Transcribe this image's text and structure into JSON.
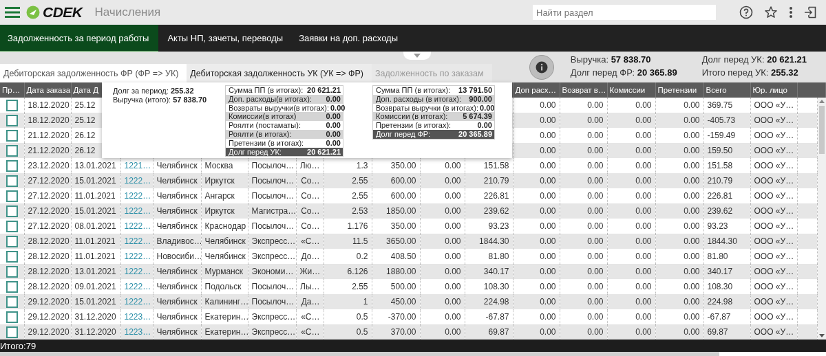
{
  "header": {
    "logo": "CDEK",
    "title": "Начисления",
    "search": {
      "placeholder": "Найти раздел"
    }
  },
  "nav_tabs": [
    {
      "label": "Задолженность за период работы",
      "selected": true
    },
    {
      "label": "Акты НП, зачеты, переводы",
      "selected": false
    },
    {
      "label": "Заявки на доп. расходы",
      "selected": false
    }
  ],
  "sub_tabs": [
    {
      "label": "Дебиторская задолженность ФР (ФР => УК)",
      "selected": true,
      "disabled": false
    },
    {
      "label": "Дебиторская задолженность УК (УК => ФР)",
      "selected": false,
      "disabled": false
    },
    {
      "label": "Задолженность по заказам",
      "selected": false,
      "disabled": true
    }
  ],
  "summary": [
    {
      "label": "Выручка:",
      "value": "57 838.70"
    },
    {
      "label": "Долг перед ФР:",
      "value": "20 365.89"
    },
    {
      "label": "Долг перед УК:",
      "value": "20 621.21"
    },
    {
      "label": "Итого перед УК:",
      "value": "255.32"
    }
  ],
  "popup": {
    "lines": [
      {
        "label": "Долг за период:",
        "value": "255.32"
      },
      {
        "label": "Выручка (итого):",
        "value": "57 838.70"
      }
    ],
    "tables": [
      {
        "rows": [
          {
            "label": "Сумма ПП (в итогах):",
            "value": "20 621.21"
          },
          {
            "label": "Доп. расходы(в итогах):",
            "value": "0.00"
          },
          {
            "label": "Возвраты выручки(в итогах):",
            "value": "0.00"
          },
          {
            "label": "Комиссии(в итогах)",
            "value": "0.00"
          },
          {
            "label": "Роялти (постаматы):",
            "value": "0.00"
          },
          {
            "label": "Роялти (в итогах):",
            "value": "0.00"
          },
          {
            "label": "Претензии (в итогах):",
            "value": "0.00"
          }
        ],
        "total": {
          "label": "Долг перед УК:",
          "value": "20 621.21"
        }
      },
      {
        "rows": [
          {
            "label": "Сумма ПП (в итогах):",
            "value": "13 791.50"
          },
          {
            "label": "Доп. расходы (в итогах):",
            "value": "900.00"
          },
          {
            "label": "Возвраты выручки (в итогах):",
            "value": "0.00"
          },
          {
            "label": "Комиссии (в итогах):",
            "value": "5 674.39"
          },
          {
            "label": "Претензии (в итогах):",
            "value": "0.00"
          }
        ],
        "total": {
          "label": "Долг перед ФР:",
          "value": "20 365.89"
        }
      }
    ]
  },
  "table": {
    "checkbox_column": "Пр…",
    "columns": [
      "Дата заказа",
      "Дата Д",
      null,
      null,
      null,
      null,
      null,
      null,
      null,
      null,
      null,
      "Доп расх…",
      "Возврат в…",
      "Комиссии",
      "Претензии",
      "Всего",
      "Юр. лицо"
    ],
    "rows": [
      {
        "checked": false,
        "cells": [
          "18.12.2020",
          "25.12",
          null,
          null,
          null,
          null,
          null,
          null,
          null,
          null,
          null,
          "0.00",
          "0.00",
          "0.00",
          "0.00",
          "369.75",
          "ООО «У…"
        ]
      },
      {
        "checked": false,
        "cells": [
          "18.12.2020",
          "25.12",
          null,
          null,
          null,
          null,
          null,
          null,
          null,
          null,
          null,
          "0.00",
          "0.00",
          "0.00",
          "0.00",
          "-405.73",
          "ООО «У…"
        ]
      },
      {
        "checked": false,
        "cells": [
          "21.12.2020",
          "26.12",
          null,
          null,
          null,
          null,
          null,
          null,
          null,
          null,
          null,
          "0.00",
          "0.00",
          "0.00",
          "0.00",
          "-159.49",
          "ООО «У…"
        ]
      },
      {
        "checked": false,
        "cells": [
          "21.12.2020",
          "26.12",
          null,
          null,
          null,
          null,
          null,
          null,
          null,
          null,
          null,
          "0.00",
          "0.00",
          "0.00",
          "0.00",
          "159.50",
          "ООО «У…"
        ]
      },
      {
        "checked": false,
        "cells": [
          "23.12.2020",
          "13.01.2021",
          "1221…",
          "Челябинск",
          "Москва",
          "Посылоч…",
          "Лю…",
          "1.3",
          "350.00",
          "0.00",
          "151.58",
          "0.00",
          "0.00",
          "0.00",
          "0.00",
          "151.58",
          "ООО «У…"
        ]
      },
      {
        "checked": false,
        "cells": [
          "27.12.2020",
          "15.01.2021",
          "1222…",
          "Челябинск",
          "Иркутск",
          "Посылоч…",
          "Со…",
          "2.55",
          "600.00",
          "0.00",
          "210.79",
          "0.00",
          "0.00",
          "0.00",
          "0.00",
          "210.79",
          "ООО «У…"
        ]
      },
      {
        "checked": false,
        "cells": [
          "27.12.2020",
          "11.01.2021",
          "1222…",
          "Челябинск",
          "Ангарск",
          "Посылоч…",
          "Со…",
          "2.55",
          "600.00",
          "0.00",
          "226.81",
          "0.00",
          "0.00",
          "0.00",
          "0.00",
          "226.81",
          "ООО «У…"
        ]
      },
      {
        "checked": false,
        "cells": [
          "27.12.2020",
          "15.01.2021",
          "1222…",
          "Челябинск",
          "Иркутск",
          "Магистра…",
          "Со…",
          "2.53",
          "1850.00",
          "0.00",
          "239.62",
          "0.00",
          "0.00",
          "0.00",
          "0.00",
          "239.62",
          "ООО «У…"
        ]
      },
      {
        "checked": false,
        "cells": [
          "27.12.2020",
          "08.01.2021",
          "1222…",
          "Челябинск",
          "Краснодар",
          "Посылоч…",
          "Со…",
          "1.176",
          "350.00",
          "0.00",
          "93.23",
          "0.00",
          "0.00",
          "0.00",
          "0.00",
          "93.23",
          "ООО «У…"
        ]
      },
      {
        "checked": false,
        "cells": [
          "28.12.2020",
          "11.01.2021",
          "1222…",
          "Владивос…",
          "Челябинск",
          "Экспресс…",
          "«С…",
          "11.5",
          "3650.00",
          "0.00",
          "1844.30",
          "0.00",
          "0.00",
          "0.00",
          "0.00",
          "1844.30",
          "ООО «У…"
        ]
      },
      {
        "checked": false,
        "cells": [
          "28.12.2020",
          "11.01.2021",
          "1222…",
          "Новосиби…",
          "Челябинск",
          "Экспресс…",
          "До…",
          "0.2",
          "408.50",
          "0.00",
          "81.80",
          "0.00",
          "0.00",
          "0.00",
          "0.00",
          "81.80",
          "ООО «У…"
        ]
      },
      {
        "checked": false,
        "cells": [
          "28.12.2020",
          "13.01.2021",
          "1222…",
          "Челябинск",
          "Мурманск",
          "Экономи…",
          "Жи…",
          "6.126",
          "1880.00",
          "0.00",
          "340.17",
          "0.00",
          "0.00",
          "0.00",
          "0.00",
          "340.17",
          "ООО «У…"
        ]
      },
      {
        "checked": false,
        "cells": [
          "28.12.2020",
          "09.01.2021",
          "1222…",
          "Челябинск",
          "Подольск",
          "Посылоч…",
          "Лы…",
          "2.55",
          "500.00",
          "0.00",
          "108.30",
          "0.00",
          "0.00",
          "0.00",
          "0.00",
          "108.30",
          "ООО «У…"
        ]
      },
      {
        "checked": false,
        "cells": [
          "29.12.2020",
          "15.01.2021",
          "1222…",
          "Челябинск",
          "Калининг…",
          "Посылоч…",
          "Да…",
          "1",
          "450.00",
          "0.00",
          "224.98",
          "0.00",
          "0.00",
          "0.00",
          "0.00",
          "224.98",
          "ООО «У…"
        ]
      },
      {
        "checked": false,
        "cells": [
          "29.12.2020",
          "31.12.2020",
          "1223…",
          "Челябинск",
          "Екатерин…",
          "Экспресс…",
          "«С…",
          "0.5",
          "-370.00",
          "0.00",
          "-67.87",
          "0.00",
          "0.00",
          "0.00",
          "0.00",
          "-67.87",
          "ООО «У…"
        ]
      },
      {
        "checked": false,
        "cells": [
          "29.12.2020",
          "31.12.2020",
          "1223…",
          "Челябинск",
          "Екатерин…",
          "Экспресс…",
          "«С…",
          "0.5",
          "370.00",
          "0.00",
          "69.87",
          "0.00",
          "0.00",
          "0.00",
          "0.00",
          "69.87",
          "ООО «У…"
        ]
      }
    ]
  },
  "status_bar": {
    "total": "Итого:79"
  }
}
